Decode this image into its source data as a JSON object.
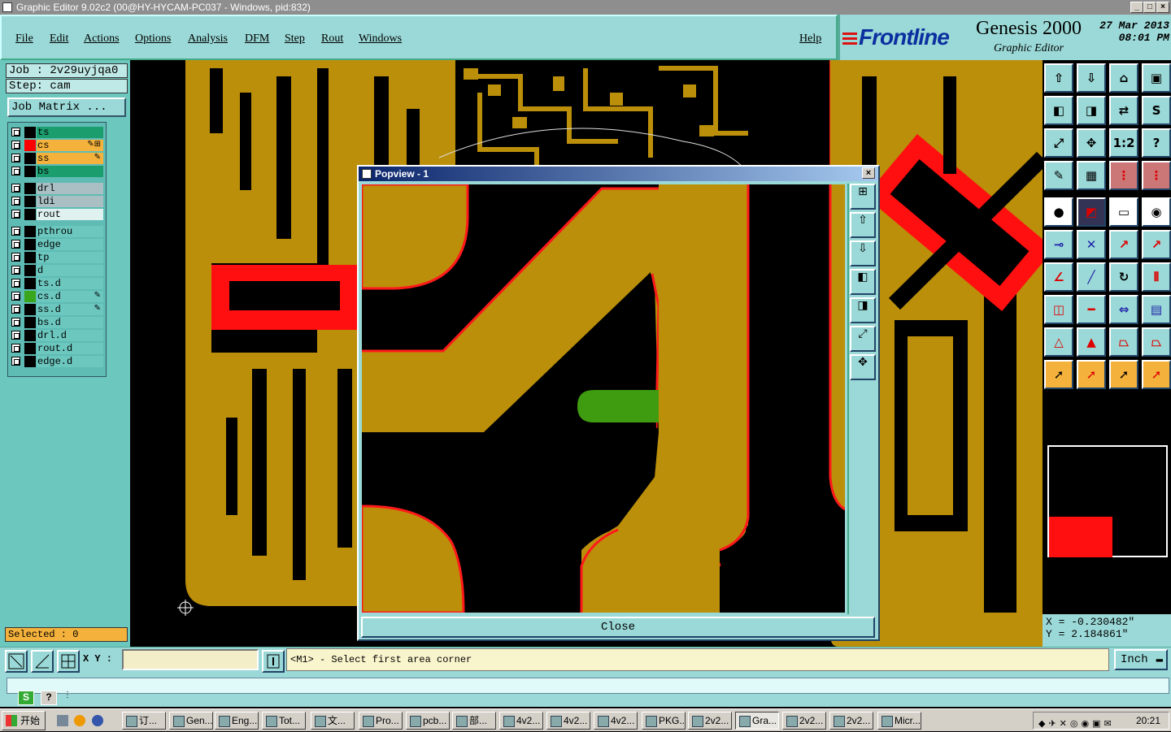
{
  "window": {
    "title": "Graphic Editor 9.02c2 (00@HY-HYCAM-PC037 - Windows, pid:832)"
  },
  "menu": {
    "items": [
      "File",
      "Edit",
      "Actions",
      "Options",
      "Analysis",
      "DFM",
      "Step",
      "Rout",
      "Windows"
    ],
    "help": "Help"
  },
  "brand": {
    "logo": "Frontline",
    "product": "Genesis 2000",
    "subtitle": "Graphic Editor",
    "date": "27 Mar 2013",
    "time": "08:01 PM"
  },
  "job": {
    "job_label": "Job : 2v29uyjqa0",
    "step_label": "Step: cam",
    "matrix_button": "Job Matrix ..."
  },
  "layers": [
    {
      "name": "ts",
      "color": "#1b9d6e",
      "swatch": "#000",
      "edit": ""
    },
    {
      "name": "cs",
      "color": "#f4b23c",
      "swatch": "#ff0000",
      "edit": "✎⊞",
      "highlight": true
    },
    {
      "name": "ss",
      "color": "#f4b23c",
      "swatch": "#000",
      "edit": "✎"
    },
    {
      "name": "bs",
      "color": "#1b9d6e",
      "swatch": "#000",
      "edit": ""
    },
    {
      "name": "drl",
      "color": "#a9bfc3",
      "swatch": "#000",
      "edit": ""
    },
    {
      "name": "ldi",
      "color": "#a9bfc3",
      "swatch": "#000",
      "edit": ""
    },
    {
      "name": "rout",
      "color": "#dff2f0",
      "swatch": "#000",
      "edit": ""
    },
    {
      "name": "pthrou",
      "color": "#6cc7bf",
      "swatch": "#000",
      "edit": ""
    },
    {
      "name": "edge",
      "color": "#6cc7bf",
      "swatch": "#000",
      "edit": ""
    },
    {
      "name": "tp",
      "color": "#6cc7bf",
      "swatch": "#000",
      "edit": ""
    },
    {
      "name": "d",
      "color": "#6cc7bf",
      "swatch": "#000",
      "edit": ""
    },
    {
      "name": "ts.d",
      "color": "#6cc7bf",
      "swatch": "#000",
      "edit": ""
    },
    {
      "name": "cs.d",
      "color": "#6cc7bf",
      "swatch": "#3aa61c",
      "edit": "✎"
    },
    {
      "name": "ss.d",
      "color": "#6cc7bf",
      "swatch": "#000",
      "edit": "✎"
    },
    {
      "name": "bs.d",
      "color": "#6cc7bf",
      "swatch": "#000",
      "edit": ""
    },
    {
      "name": "drl.d",
      "color": "#6cc7bf",
      "swatch": "#000",
      "edit": ""
    },
    {
      "name": "rout.d",
      "color": "#6cc7bf",
      "swatch": "#000",
      "edit": ""
    },
    {
      "name": "edge.d",
      "color": "#6cc7bf",
      "swatch": "#000",
      "edit": ""
    }
  ],
  "selection": {
    "label": "Selected : 0"
  },
  "popview": {
    "title": "Popview - 1",
    "close_label": "Close"
  },
  "coordinates": {
    "x": "X = -0.230482\"",
    "y": "Y = 2.184861\""
  },
  "command": {
    "xy_label": "X Y :",
    "xy_value": "",
    "prompt": "<M1> - Select first area corner",
    "unit": "Inch"
  },
  "taskbar": {
    "start": "开始",
    "tasks": [
      "订...",
      "Gen...",
      "Eng...",
      "Tot...",
      "文...",
      "Pro...",
      "pcb...",
      "部...",
      "4v2...",
      "4v2...",
      "4v2...",
      "PKG...",
      "2v2...",
      "Gra...",
      "2v2...",
      "2v2...",
      "Micr..."
    ],
    "active": "Gra...",
    "clock": "20:21"
  },
  "colors": {
    "copper": "#bb8f0a",
    "trace_outline": "#ff1a1a",
    "background": "#000000",
    "panel": "#9ad9d7",
    "pad_green": "#3f9b10"
  }
}
